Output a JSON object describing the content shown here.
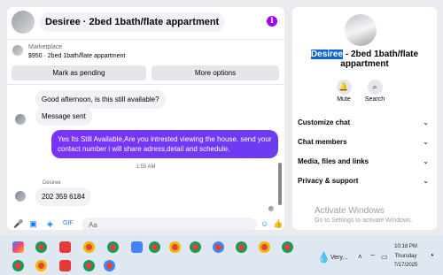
{
  "chat": {
    "title": "Desiree · 2bed 1bath/flate appartment",
    "marketplace_label": "Marketplace",
    "listing": "$950 · 2bed 1bath/flate appartment",
    "mark_pending": "Mark as pending",
    "more_options": "More options",
    "messages": [
      {
        "text": "Good afternoon, is this still available?"
      },
      {
        "text": "Message sent"
      },
      {
        "text": "Yes Its Still Available,Are you intrested viewing the house. send your contact number i will share adress,detail and schedule."
      },
      {
        "text": "202 359 6184"
      }
    ],
    "time": "1:55 AM",
    "sender": "Desiree",
    "input_placeholder": "Aa"
  },
  "side": {
    "name_highlight": "Desiree",
    "name_rest": " - 2bed 1bath/flate appartment",
    "mute": "Mute",
    "search": "Search",
    "rows": [
      "Customize chat",
      "Chat members",
      "Media, files and links",
      "Privacy & support"
    ]
  },
  "watermark": {
    "title": "Activate Windows",
    "subtitle": "Go to Settings to activate Windows."
  },
  "taskbar": {
    "weather": "Very...",
    "time": "10:18 PM",
    "day": "Thursday",
    "date": "7/17/2025"
  },
  "colors": {
    "accent": "#7a33ff",
    "messenger_blue": "#0a7cff"
  }
}
